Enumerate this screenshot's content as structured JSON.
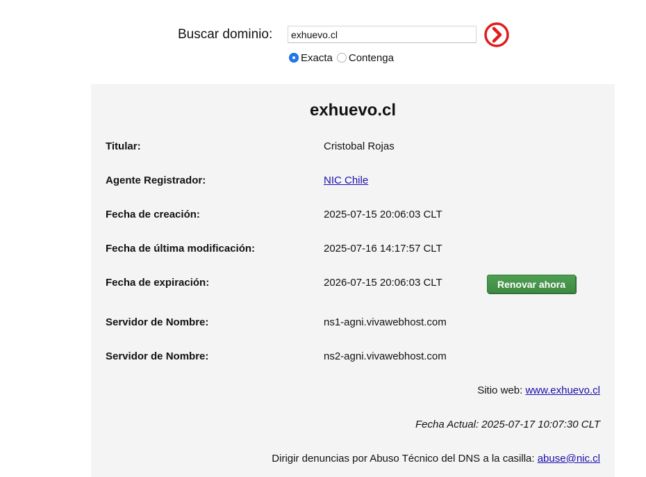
{
  "search": {
    "label": "Buscar dominio:",
    "value": "exhuevo.cl",
    "go_icon": "circle-chevron-right-icon",
    "go_color": "#e01b1b",
    "options": [
      {
        "label": "Exacta",
        "selected": true
      },
      {
        "label": "Contenga",
        "selected": false
      }
    ]
  },
  "domain": {
    "name": "exhuevo.cl",
    "rows": [
      {
        "label": "Titular:",
        "value": "Cristobal Rojas"
      },
      {
        "label": "Agente Registrador:",
        "value": "NIC Chile"
      },
      {
        "label": "Fecha de creación:",
        "value": "2025-07-15 20:06:03 CLT"
      },
      {
        "label": "Fecha de última modificación:",
        "value": "2025-07-16 14:17:57 CLT"
      },
      {
        "label": "Fecha de expiración:",
        "value": "2026-07-15 20:06:03 CLT"
      },
      {
        "label": "Servidor de Nombre:",
        "value": "ns1-agni.vivawebhost.com"
      },
      {
        "label": "Servidor de Nombre:",
        "value": "ns2-agni.vivawebhost.com"
      }
    ],
    "renew_label": "Renovar ahora",
    "renew_color": "#46944a"
  },
  "footer": {
    "website_label": "Sitio web:",
    "website_link": "www.exhuevo.cl",
    "current_date": "Fecha Actual: 2025-07-17 10:07:30 CLT",
    "abuse_text": "Dirigir denuncias por Abuso Técnico del DNS a la casilla:",
    "abuse_email": "abuse@nic.cl"
  }
}
